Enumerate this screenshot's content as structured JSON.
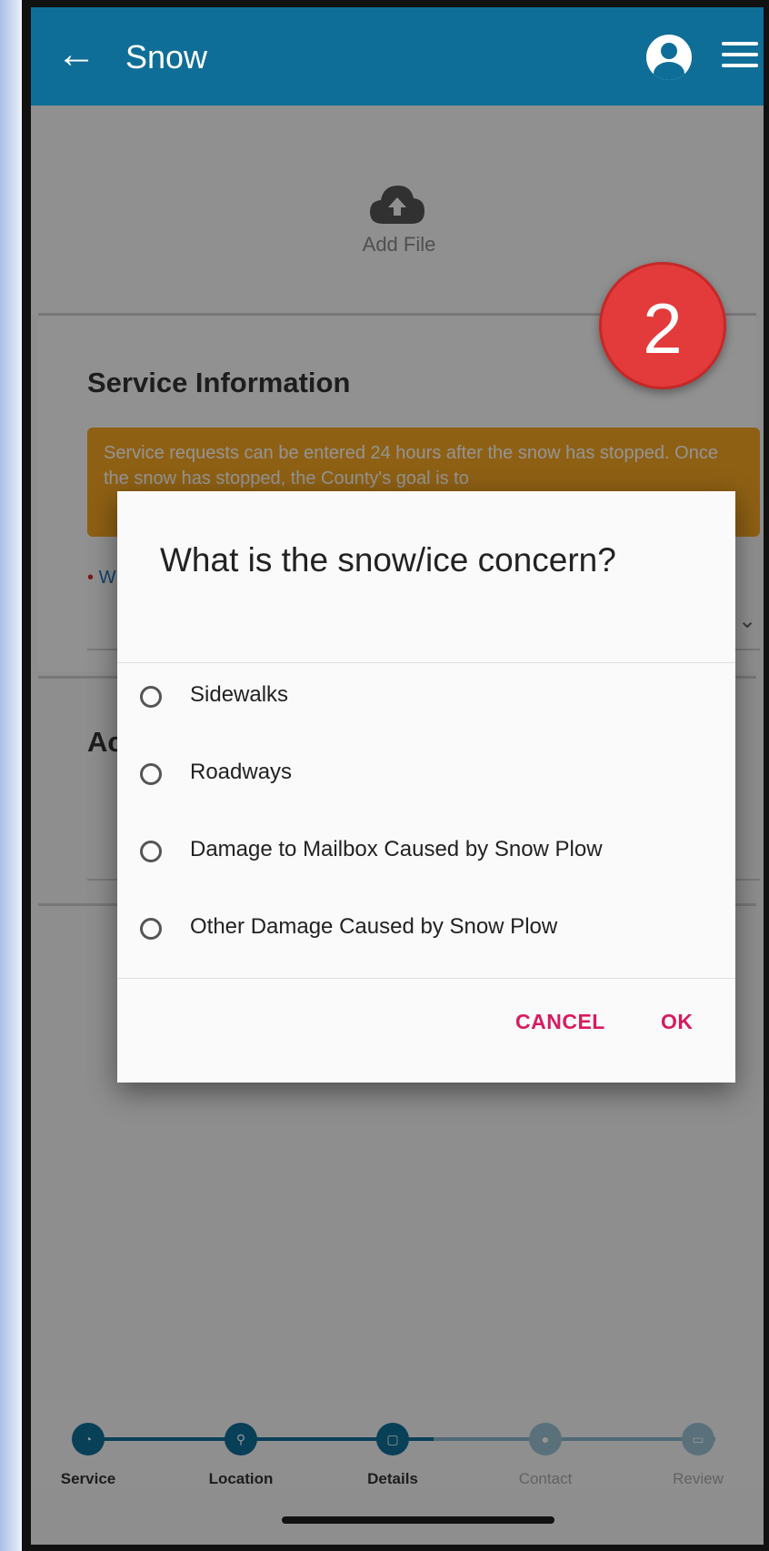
{
  "header": {
    "back_icon": "arrow-left-icon",
    "title": "Snow",
    "profile_icon": "account-circle-icon",
    "menu_icon": "hamburger-menu-icon"
  },
  "upload": {
    "icon": "cloud-upload-icon",
    "label": "Add File"
  },
  "annotation": {
    "number": "2",
    "color": "#e33b3b"
  },
  "service_info": {
    "title": "Service Information",
    "notice": "Service requests can be entered 24 hours after the snow has stopped. Once the snow has stopped, the County's goal is to",
    "notice_color": "#f5a623",
    "required_marker": "•",
    "field_label_partial": "W"
  },
  "section2": {
    "title_partial": "Ac"
  },
  "dialog": {
    "title": "What is the snow/ice concern?",
    "options": [
      "Sidewalks",
      "Roadways",
      "Damage to Mailbox Caused by Snow Plow",
      "Other Damage Caused by Snow Plow"
    ],
    "cancel_label": "CANCEL",
    "ok_label": "OK",
    "button_color": "#d81b60"
  },
  "stepper": {
    "steps": [
      {
        "label": "Service",
        "active": true
      },
      {
        "label": "Location",
        "active": true
      },
      {
        "label": "Details",
        "active": true
      },
      {
        "label": "Contact",
        "active": false
      },
      {
        "label": "Review",
        "active": false
      }
    ]
  },
  "colors": {
    "appbar": "#0f6e98"
  }
}
